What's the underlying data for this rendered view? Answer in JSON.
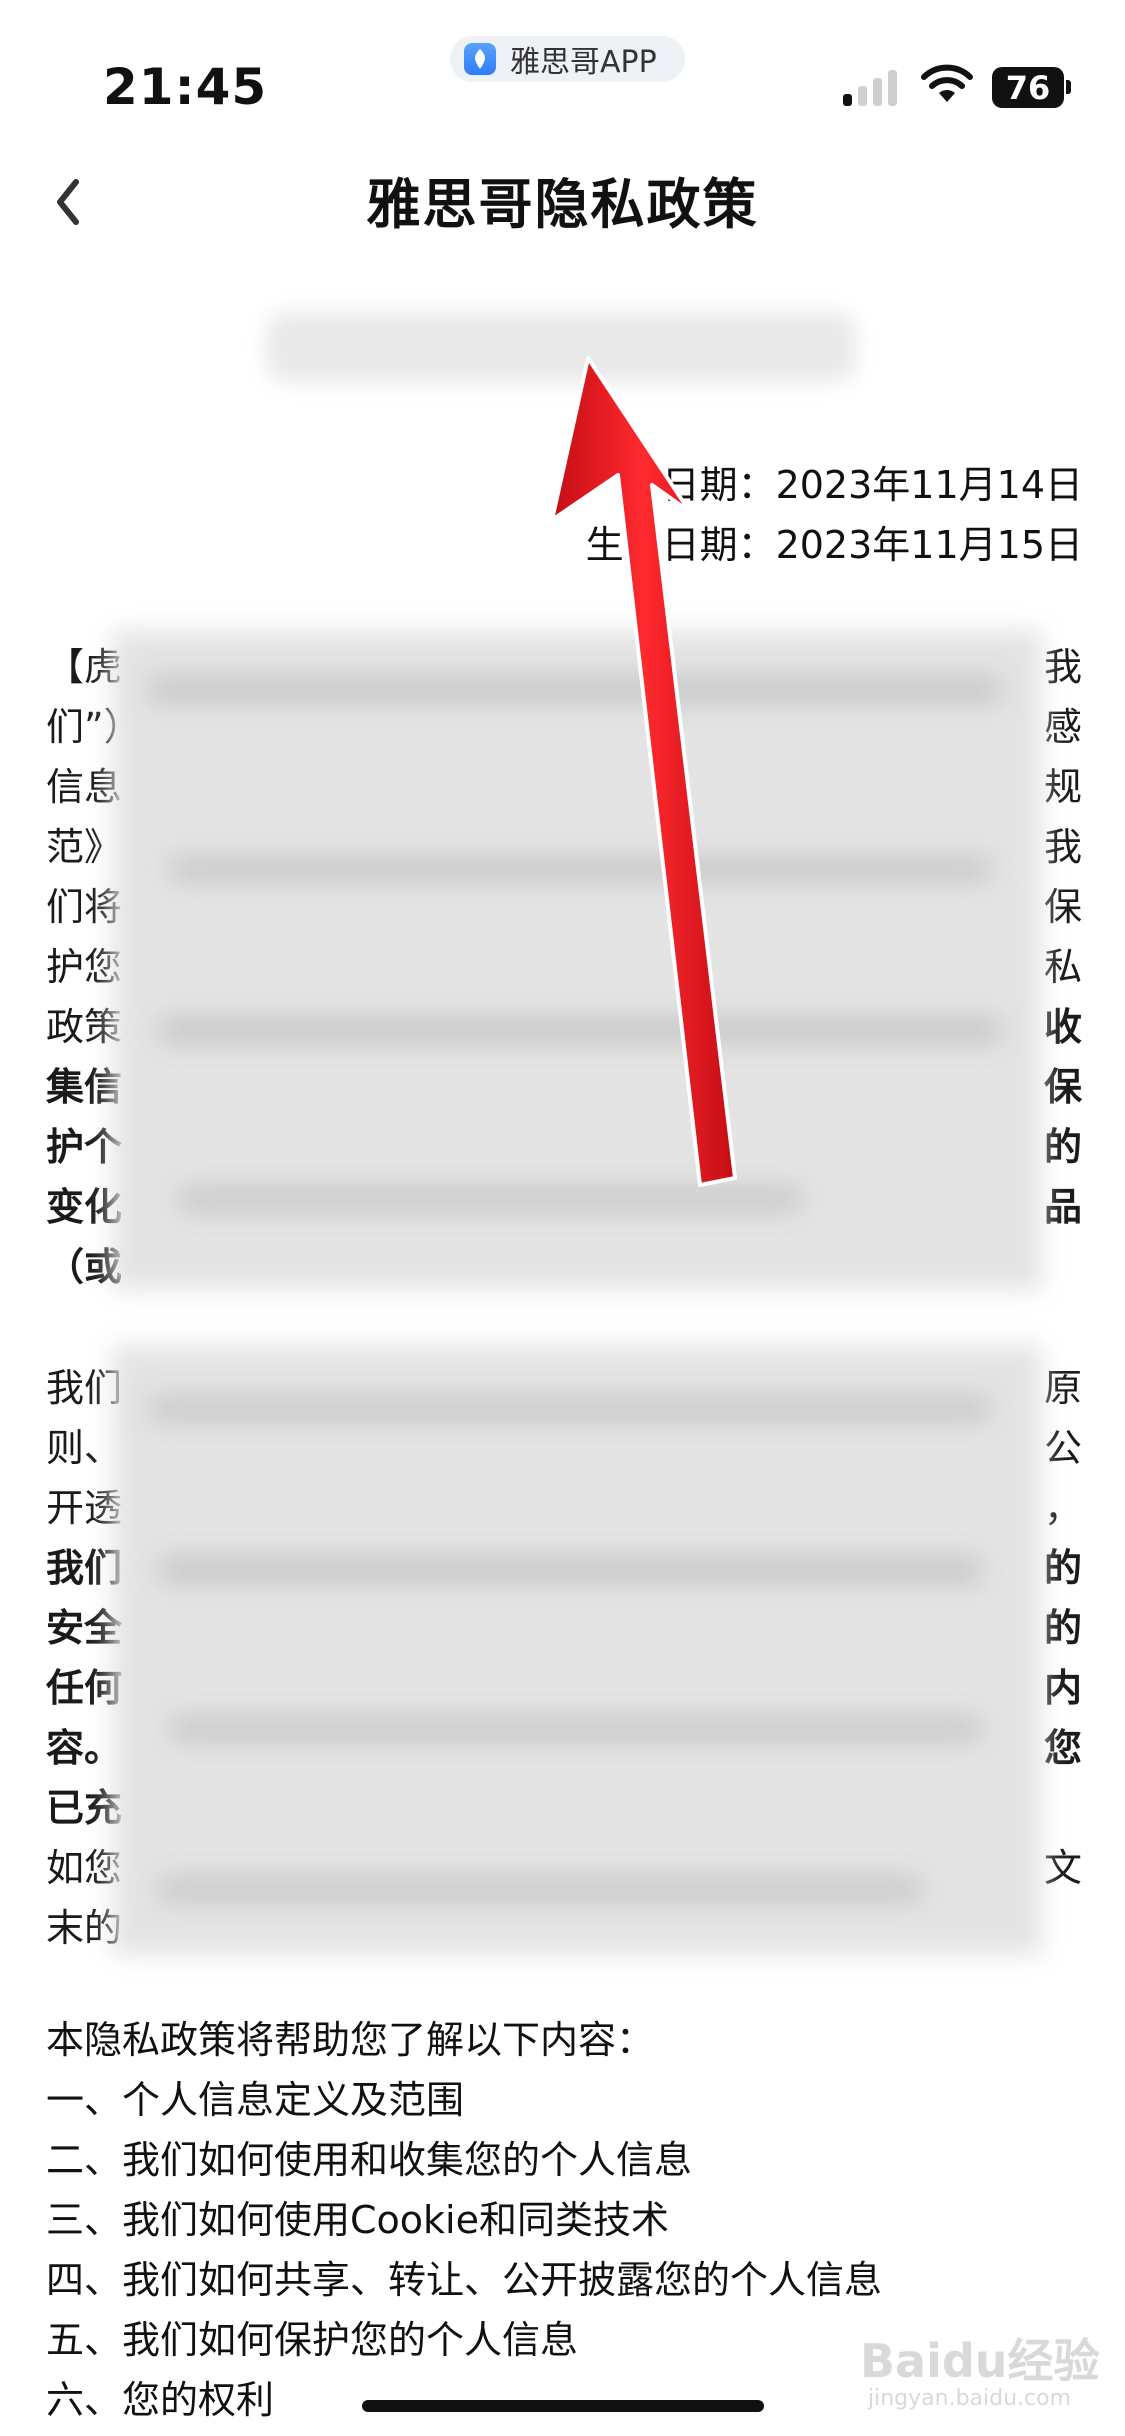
{
  "status_bar": {
    "time": "21:45",
    "app_pill_label": "雅思哥APP",
    "battery": "76"
  },
  "nav": {
    "title": "雅思哥隐私政策",
    "back_icon": "chevron-left-icon"
  },
  "dates": {
    "update_label": "日期：2023年11月14日",
    "effective_label": "生效日期：2023年11月15日"
  },
  "intro": {
    "lines": [
      {
        "left": "【虎",
        "right": "我",
        "bold": false
      },
      {
        "left": "们”）",
        "right": "感",
        "bold": false
      },
      {
        "left": "信息",
        "right": "规",
        "bold": false
      },
      {
        "left": "范》",
        "right": "我",
        "bold": false
      },
      {
        "left": "们将",
        "right": "保",
        "bold": false
      },
      {
        "left": "护您",
        "right": "私",
        "bold": false
      },
      {
        "left": "政策",
        "right": "收",
        "bold": true
      },
      {
        "left": "集信",
        "right": "保",
        "bold": true
      },
      {
        "left": "护个",
        "right": "的",
        "bold": true
      },
      {
        "left": "变化",
        "right": "品",
        "bold": true
      },
      {
        "left": "（或",
        "right": "",
        "bold": true
      }
    ]
  },
  "principles": {
    "lines": [
      {
        "left": "我们",
        "right": "原",
        "bold": false
      },
      {
        "left": "则、",
        "right": "公",
        "bold": false
      },
      {
        "left": "开透",
        "right": "，",
        "bold": false
      },
      {
        "left": "我们",
        "right": "的",
        "bold": true
      },
      {
        "left": "安全",
        "right": "的",
        "bold": true
      },
      {
        "left": "任何",
        "right": "内",
        "bold": true
      },
      {
        "left": "容。",
        "right": "您",
        "bold": true
      },
      {
        "left": "已充",
        "right": "",
        "bold": true
      },
      {
        "left": "如您",
        "right": "文",
        "bold": false
      },
      {
        "left": "末的",
        "right": "",
        "bold": false
      }
    ]
  },
  "toc": {
    "heading": "本隐私政策将帮助您了解以下内容：",
    "items": [
      "一、个人信息定义及范围",
      "二、我们如何使用和收集您的个人信息",
      "三、我们如何使用Cookie和同类技术",
      "四、我们如何共享、转让、公开披露您的个人信息",
      "五、我们如何保护您的个人信息",
      "六、您的权利"
    ]
  },
  "watermark": {
    "text": "Baidu经验",
    "sub": "jingyan.baidu.com"
  },
  "colors": {
    "annotation_arrow": "#e8141c",
    "text": "#111111",
    "background": "#ffffff"
  }
}
